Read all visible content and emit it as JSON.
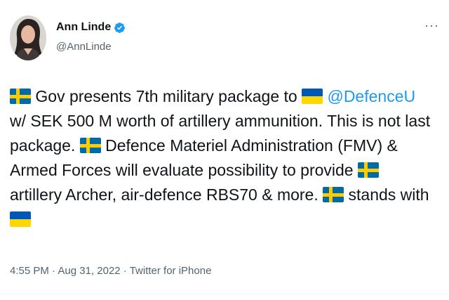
{
  "author": {
    "display_name": "Ann Linde",
    "handle": "@AnnLinde",
    "verified_icon": "verified-badge-icon",
    "avatar_icon": "profile-photo"
  },
  "more_icon": "more-options-icon",
  "more_glyph": "···",
  "tweet": {
    "part1": " Gov presents 7th military package to ",
    "mention": "@DefenceU",
    "part2": " w/ SEK 500 M worth of artillery ammunition. This is not last package. ",
    "part3": " Defence Materiel Administration (FMV) & Armed Forces will evaluate possibility to provide ",
    "part4": " artillery Archer, air-defence RBS70 & more. ",
    "part5": " stands with "
  },
  "meta": {
    "time": "4:55 PM",
    "separator": " · ",
    "date": "Aug 31, 2022",
    "client": "Twitter for iPhone"
  },
  "colors": {
    "link": "#1d9bf0",
    "verified": "#1d9bf0",
    "secondary_text": "#536471"
  }
}
